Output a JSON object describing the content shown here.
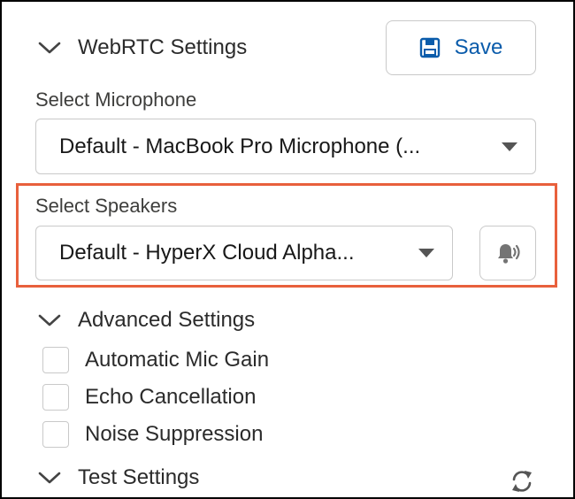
{
  "webrtc": {
    "title": "WebRTC Settings",
    "save_label": "Save"
  },
  "microphone": {
    "label": "Select Microphone",
    "value": "Default - MacBook Pro Microphone (..."
  },
  "speakers": {
    "label": "Select Speakers",
    "value": "Default - HyperX Cloud Alpha...",
    "highlight_color": "#e8603c"
  },
  "advanced": {
    "title": "Advanced Settings",
    "options": [
      {
        "label": "Automatic Mic Gain",
        "checked": false
      },
      {
        "label": "Echo Cancellation",
        "checked": false
      },
      {
        "label": "Noise Suppression",
        "checked": false
      }
    ]
  },
  "test": {
    "title": "Test Settings"
  },
  "colors": {
    "accent": "#0b5cab",
    "border": "#c9c9c9"
  },
  "icons": {
    "save": "floppy-disk-icon",
    "test_speaker": "speaker-bell-icon",
    "refresh": "refresh-icon"
  }
}
